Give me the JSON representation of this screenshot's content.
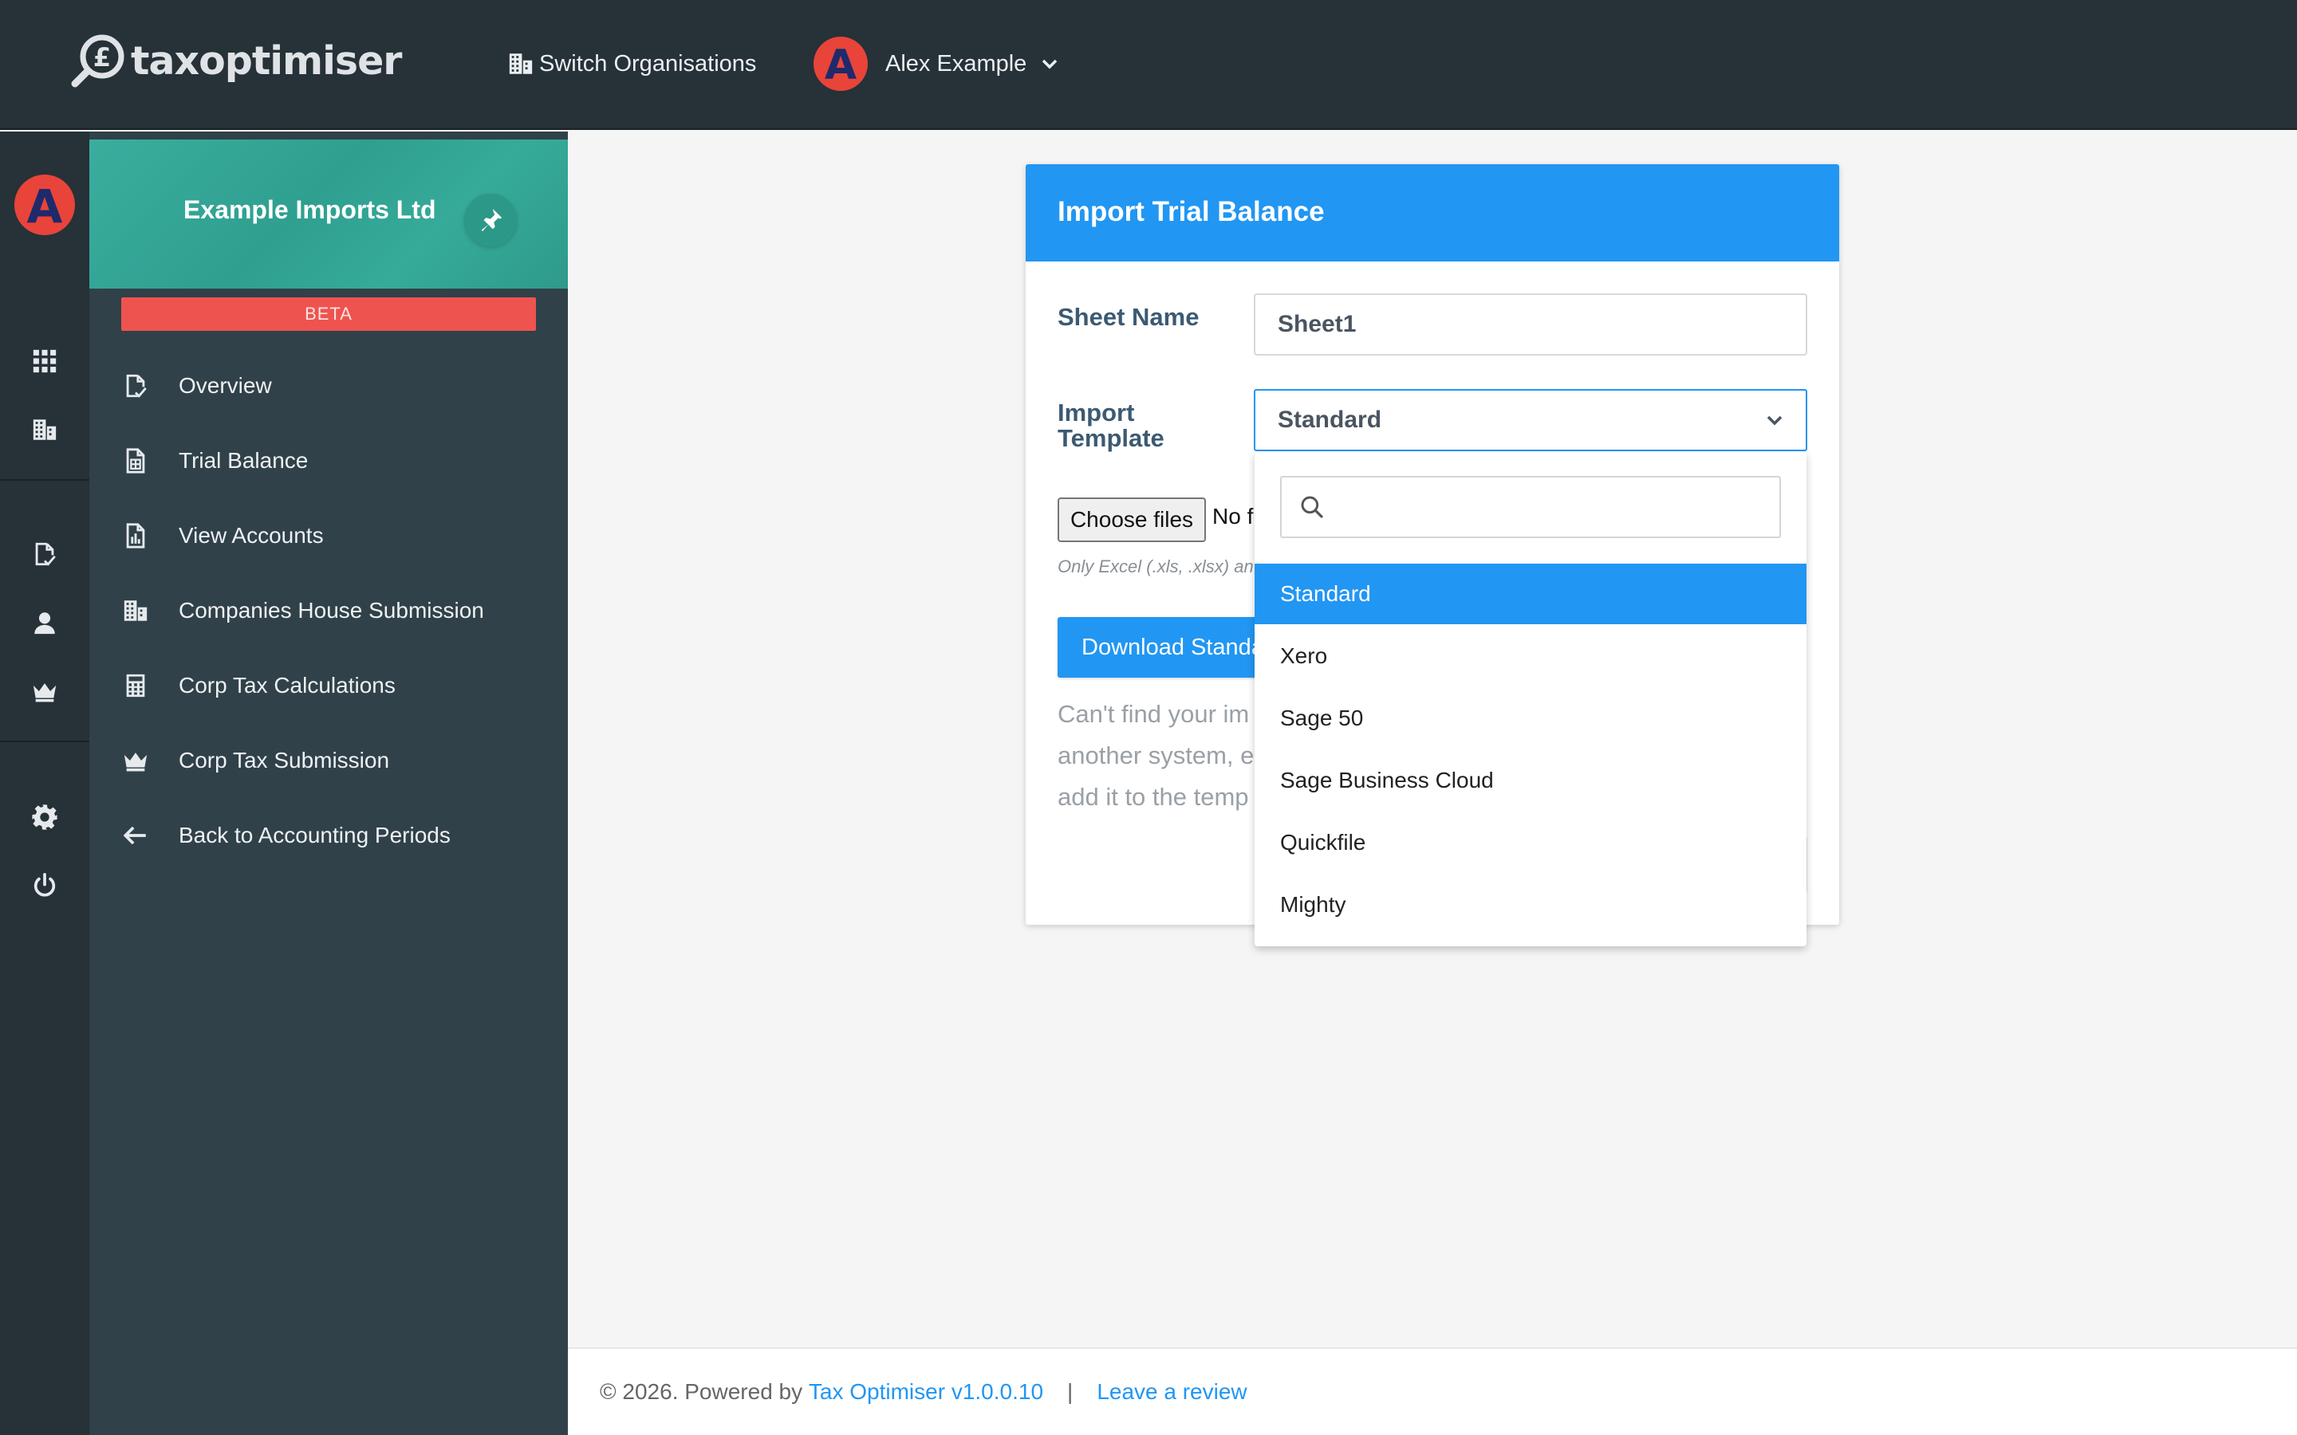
{
  "app": {
    "logo_text": "taxoptimiser",
    "switch_org_label": "Switch Organisations",
    "user_initial": "A",
    "user_name": "Alex Example"
  },
  "sidebar": {
    "org_name": "Example Imports Ltd",
    "badge": "BETA",
    "items": [
      {
        "label": "Overview",
        "icon": "document-check-icon"
      },
      {
        "label": "Trial Balance",
        "icon": "spreadsheet-icon"
      },
      {
        "label": "View Accounts",
        "icon": "report-chart-icon"
      },
      {
        "label": "Companies House Submission",
        "icon": "buildings-icon"
      },
      {
        "label": "Corp Tax Calculations",
        "icon": "calculator-icon"
      },
      {
        "label": "Corp Tax Submission",
        "icon": "crown-icon"
      },
      {
        "label": "Back to Accounting Periods",
        "icon": "arrow-left-icon"
      }
    ]
  },
  "rail": {
    "icons": [
      "avatar",
      "grid-icon",
      "buildings-icon",
      "document-check-icon",
      "user-icon",
      "crown-icon",
      "gear-icon",
      "power-icon"
    ]
  },
  "card": {
    "title": "Import Trial Balance",
    "sheet_name_label": "Sheet Name",
    "sheet_name_value": "Sheet1",
    "import_template_label_line1": "Import",
    "import_template_label_line2": "Template",
    "selected_template": "Standard",
    "choose_files_label": "Choose files",
    "no_file_text": "No f",
    "file_hint": "Only Excel (.xls, .xlsx) an",
    "download_label": "Download Standa",
    "help_line1": "Can't find your im",
    "help_line2": "another system, e",
    "help_line3": "add it to the temp"
  },
  "dropdown": {
    "search_placeholder": "",
    "options": [
      "Standard",
      "Xero",
      "Sage 50",
      "Sage Business Cloud",
      "Quickfile",
      "Mighty"
    ],
    "selected_index": 0
  },
  "footer": {
    "copyright": "© 2026. Powered by",
    "version_link": "Tax Optimiser v1.0.0.10",
    "separator": "|",
    "review_link": "Leave a review"
  },
  "colors": {
    "topbar": "#263138",
    "sidebar": "#304149",
    "org_header": "#36a898",
    "accent": "#2196f3",
    "beta": "#ef5350",
    "avatar": "#e8443a"
  }
}
